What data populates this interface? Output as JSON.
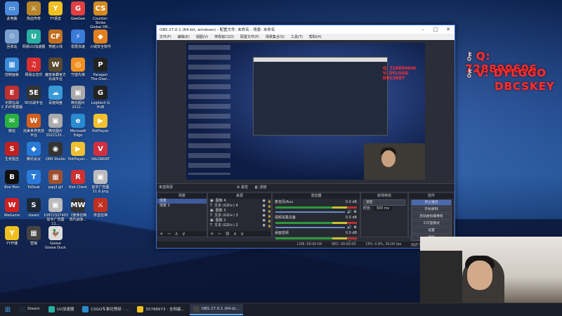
{
  "desktop": {
    "icons": [
      {
        "label": "此电脑",
        "color": "#4a8ad8",
        "glyph": "▭",
        "name": "this-pc-icon"
      },
      {
        "label": "热血传奇",
        "color": "#b8852a",
        "glyph": "⚔",
        "name": "game-icon"
      },
      {
        "label": "YY语音",
        "color": "#f0c020",
        "glyph": "Y",
        "name": "yy-icon"
      },
      {
        "label": "GeeGee",
        "color": "#e04040",
        "glyph": "G",
        "name": "geegee-icon"
      },
      {
        "label": "Counter-Strike\nGlobal Off...",
        "color": "#d48a20",
        "glyph": "CS",
        "name": "csgo-icon"
      },
      {
        "label": "回收站",
        "color": "#7aa0d0",
        "glyph": "♲",
        "name": "recycle-bin-icon"
      },
      {
        "label": "网易UU加速器",
        "color": "#2ab0a0",
        "glyph": "U",
        "name": "uu-icon"
      },
      {
        "label": "穿越火线",
        "color": "#c07020",
        "glyph": "CF",
        "name": "cf-icon"
      },
      {
        "label": "雷霆加速",
        "color": "#3a7ad8",
        "glyph": "⚡",
        "name": "thunder-icon"
      },
      {
        "label": "火绒安全软件",
        "color": "#e08020",
        "glyph": "◆",
        "name": "huorong-icon"
      },
      {
        "label": "控制面板",
        "color": "#3a8ad8",
        "glyph": "▦",
        "name": "control-panel-icon"
      },
      {
        "label": "网易云音乐",
        "color": "#d83030",
        "glyph": "♫",
        "name": "netease-music-icon"
      },
      {
        "label": "魔兽争霸官方\n对战平台",
        "color": "#5a4a30",
        "glyph": "W",
        "name": "war3-icon"
      },
      {
        "label": "守望先锋",
        "color": "#f09020",
        "glyph": "◎",
        "name": "overwatch-icon"
      },
      {
        "label": "Paragon\nThe Over...",
        "color": "#222",
        "glyph": "P",
        "name": "paragon-icon"
      },
      {
        "label": "无限征战\n2_EVE修复版",
        "color": "#c03030",
        "glyph": "E",
        "name": "eve-icon"
      },
      {
        "label": "5E对战平台",
        "color": "#333",
        "glyph": "5E",
        "name": "5e-icon"
      },
      {
        "label": "百度网盘",
        "color": "#3a9ad8",
        "glyph": "☁",
        "name": "baidu-pan-icon"
      },
      {
        "label": "微信图片\n2022...",
        "color": "#aaa",
        "glyph": "▣",
        "name": "wechat-image-icon"
      },
      {
        "label": "Logitech G\nHUB",
        "color": "#222",
        "glyph": "G",
        "name": "ghub-icon"
      },
      {
        "label": "微信",
        "color": "#2ab040",
        "glyph": "✉",
        "name": "wechat-icon"
      },
      {
        "label": "完美世界竞技\n平台",
        "color": "#d06020",
        "glyph": "W",
        "name": "perfect-world-icon"
      },
      {
        "label": "微信图片\n2022120...",
        "color": "#aaa",
        "glyph": "▣",
        "name": "wechat-image-2-icon"
      },
      {
        "label": "Microsoft\nEdge",
        "color": "#2a8ad0",
        "glyph": "e",
        "name": "edge-icon"
      },
      {
        "label": "PotPlayer",
        "color": "#f0c030",
        "glyph": "▶",
        "name": "potplayer-icon"
      },
      {
        "label": "生死狙击",
        "color": "#c02020",
        "glyph": "S",
        "name": "sszj-icon"
      },
      {
        "label": "腾讯会议",
        "color": "#2a7ad8",
        "glyph": "◆",
        "name": "tencent-meeting-icon"
      },
      {
        "label": "OBS Studio",
        "color": "#333",
        "glyph": "◉",
        "name": "obs-icon"
      },
      {
        "label": "PotPlayer...",
        "color": "#f0c030",
        "glyph": "▶",
        "name": "potplayer-2-icon"
      },
      {
        "label": "VALORANT",
        "color": "#d03040",
        "glyph": "V",
        "name": "valorant-icon"
      },
      {
        "label": "Boo Men",
        "color": "#111",
        "glyph": "B",
        "name": "boomen-icon"
      },
      {
        "label": "ToDesk",
        "color": "#2a7ad8",
        "glyph": "T",
        "name": "todesk-icon"
      },
      {
        "label": "pqq3.gif",
        "color": "#a05030",
        "glyph": "▦",
        "name": "gif-file-icon"
      },
      {
        "label": "Riot Client",
        "color": "#d03030",
        "glyph": "R",
        "name": "riot-client-icon"
      },
      {
        "label": "加字广告图\n11.6.png",
        "color": "#bbb",
        "glyph": "▣",
        "name": "png-file-icon"
      },
      {
        "label": "WeGame",
        "color": "#d02020",
        "glyph": "W",
        "name": "wegame-icon"
      },
      {
        "label": "steam",
        "color": "#1b2838",
        "glyph": "S",
        "name": "steam-icon"
      },
      {
        "label": "10872327403\n加字广告图11...",
        "color": "#bbb",
        "glyph": "▣",
        "name": "png-file-2-icon"
      },
      {
        "label": "《使命召唤\n现代战争...",
        "color": "#333",
        "glyph": "MW",
        "name": "mw-icon"
      },
      {
        "label": "传音狂神",
        "color": "#c03020",
        "glyph": "⚔",
        "name": "game-2-icon"
      },
      {
        "label": "YY开播",
        "color": "#f0c020",
        "glyph": "Y",
        "name": "yy-live-icon"
      },
      {
        "label": "营销",
        "color": "#444",
        "glyph": "▦",
        "name": "marketing-icon"
      },
      {
        "label": "Goose\nGoose Duck",
        "color": "#ddd",
        "glyph": "🦆",
        "name": "goose-icon"
      }
    ]
  },
  "overlay": {
    "qq_line": "Q: 728890606",
    "v_line1": "V: DYLGGO",
    "v_line2": "DBCSKEY"
  },
  "obs": {
    "title": "OBS 27.0.1 (64-bit, windows) - 配置文件: 未命名 - 场景: 未命名",
    "menu": [
      "文件(F)",
      "编辑(E)",
      "视图(V)",
      "停靠窗口(D)",
      "配置文件(P)",
      "场景集合(S)",
      "工具(T)",
      "帮助(H)"
    ],
    "scene_bar": {
      "source_label": "未选择源",
      "props": "属性",
      "filters": "滤镜"
    },
    "scenes": {
      "title": "场景",
      "items": [
        "场景",
        "场景 2"
      ]
    },
    "sources": {
      "title": "来源",
      "items": [
        "图像 4",
        "文本 (GDI+) 4",
        "图像 3",
        "文本 (GDI+) 3",
        "图像 2",
        "文本 (GDI+) 2"
      ]
    },
    "mixer": {
      "title": "混音器",
      "channels": [
        {
          "name": "麦克风/Aux",
          "db": "0.0 dB"
        },
        {
          "name": "视频采集设备",
          "db": "0.0 dB"
        },
        {
          "name": "桌面音频",
          "db": "0.0 dB"
        }
      ]
    },
    "transitions": {
      "title": "转场特效",
      "type": "渐变",
      "duration_label": "时长",
      "duration": "300 ms"
    },
    "controls": {
      "title": "控件",
      "buttons": [
        "停止推流",
        "开始录制",
        "启动虚拟摄像机",
        "工作室模式",
        "设置",
        "退出"
      ]
    },
    "status": {
      "live": "LIVE: 00:00:04",
      "rec": "REC: 00:00:00",
      "cpu": "CPU: 0.8%, 30.00 fps",
      "dropped": "延迟 0 ..."
    }
  },
  "preview": {
    "red_line1": "Q: 728890606",
    "red_line2": "V: DYLGGO",
    "red_line3": "DBCSKEY"
  },
  "taskbar": {
    "items": [
      {
        "label": "Steam",
        "color": "#1b2838",
        "active": false
      },
      {
        "label": "UU加速器",
        "color": "#2ab0a0",
        "active": false
      },
      {
        "label": "CSGO专事化预研 - ...",
        "color": "#2a8ad0",
        "active": false
      },
      {
        "label": "55788973 - 全网最...",
        "color": "#f0c020",
        "active": false
      },
      {
        "label": "OBS 27.0.1 (64-bi...",
        "color": "#444",
        "active": true
      }
    ]
  }
}
